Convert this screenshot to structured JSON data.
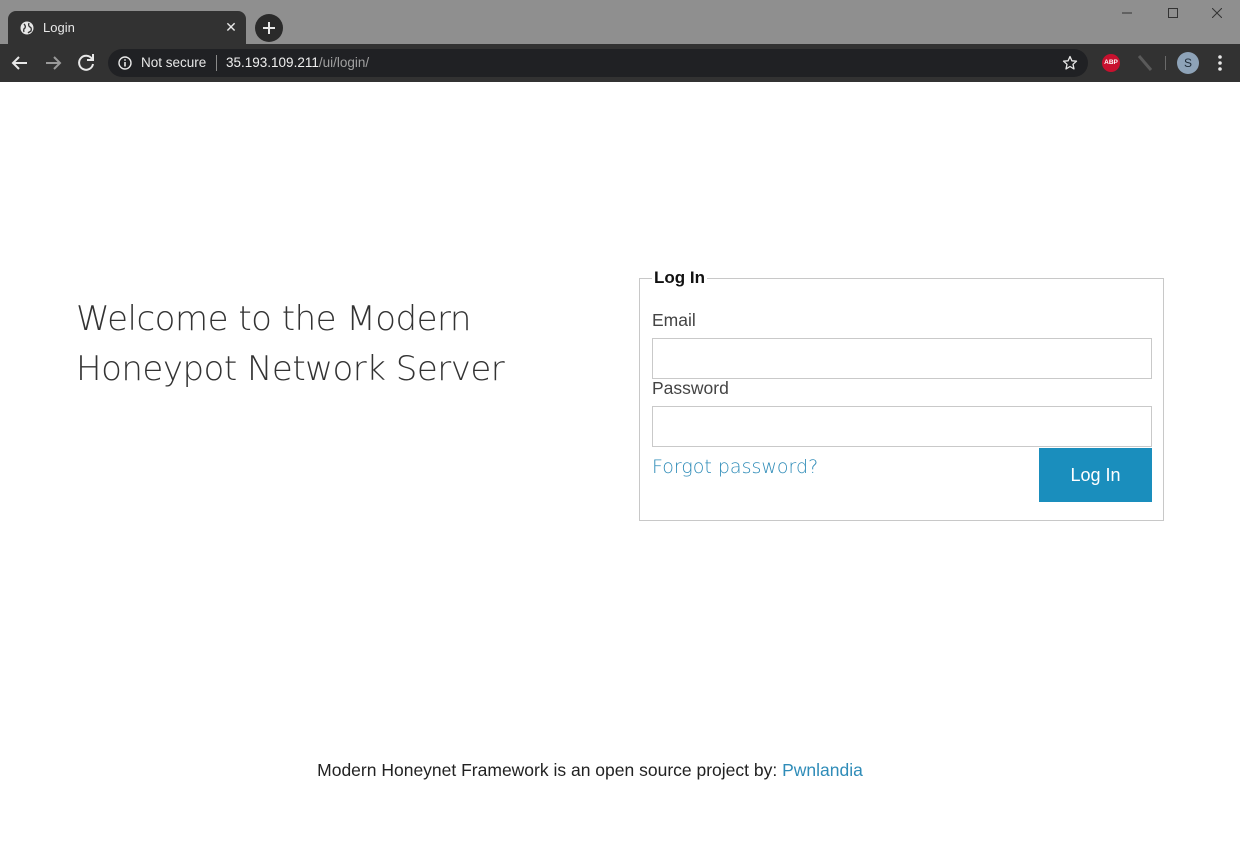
{
  "browser": {
    "tab_title": "Login",
    "tab_close_glyph": "✕",
    "security_label": "Not secure",
    "url_host": "35.193.109.211",
    "url_path": "/ui/login/",
    "ext_abp_label": "ABP",
    "avatar_initial": "S",
    "icons": [
      "globe-icon",
      "close-icon",
      "plus-icon",
      "minimize-icon",
      "maximize-icon",
      "window-close-icon",
      "back-arrow-icon",
      "forward-arrow-icon",
      "reload-icon",
      "info-icon",
      "star-icon",
      "adblock-icon",
      "extension-slash-icon",
      "kebab-menu-icon"
    ]
  },
  "page": {
    "welcome_line1": "Welcome to the Modern",
    "welcome_line2": "Honeypot Network Server"
  },
  "login_form": {
    "legend": "Log In",
    "email_label": "Email",
    "email_value": "",
    "password_label": "Password",
    "password_value": "",
    "forgot_link": "Forgot password?",
    "submit_label": "Log In"
  },
  "footer": {
    "text": "Modern Honeynet Framework is an open source project by: ",
    "link": "Pwnlandia"
  },
  "colors": {
    "accent": "#1a8ebd",
    "link": "#2f8cb8",
    "chrome_dark": "#323232",
    "titlebar": "#8f8f8f"
  }
}
